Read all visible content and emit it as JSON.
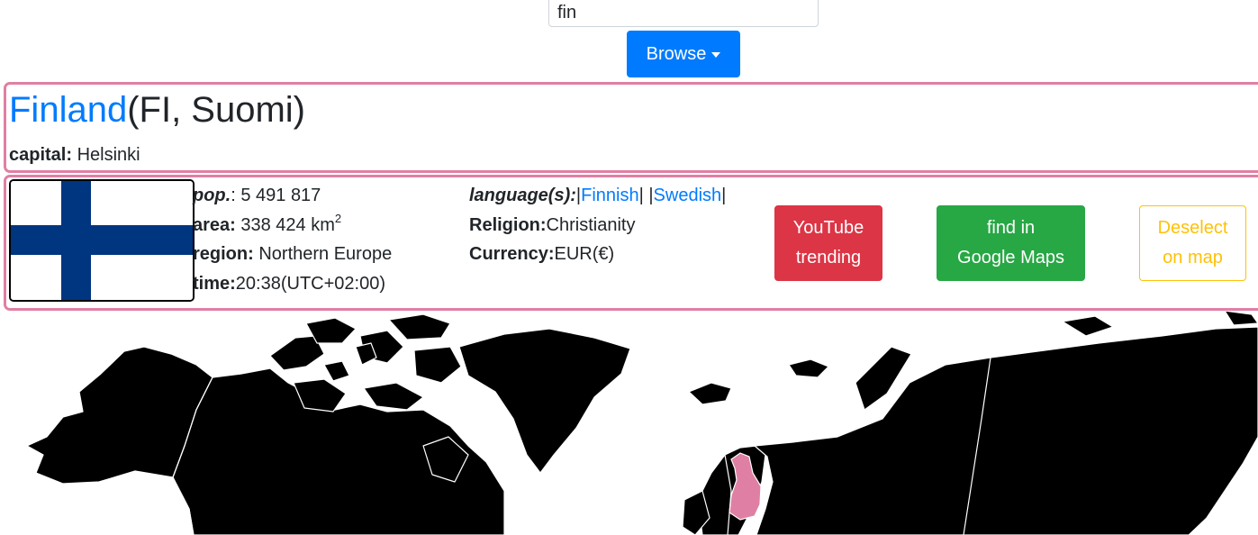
{
  "search": {
    "value": "fin",
    "placeholder": ""
  },
  "browse_button": {
    "label": "Browse"
  },
  "country": {
    "name": "Finland",
    "codes": "(FI, Suomi)",
    "capital_label": "capital:",
    "capital_value": "Helsinki"
  },
  "flag": {
    "icon": "finland-flag",
    "background_color": "#ffffff",
    "cross_color": "#003580"
  },
  "stats": {
    "population_label": "pop.",
    "population_value": ": 5 491 817",
    "area_label": "area:",
    "area_value": "338 424 km",
    "area_unit_sup": "2",
    "region_label": "region:",
    "region_value": "Northern Europe",
    "time_label": "time:",
    "time_value": "20:38(UTC+02:00)"
  },
  "culture": {
    "languages_label": "language(s):",
    "languages": [
      "Finnish",
      "Swedish"
    ],
    "religion_label": "Religion:",
    "religion_value": "Christianity",
    "currency_label": "Currency:",
    "currency_value": "EUR(€)"
  },
  "actions": {
    "youtube_line1": "YouTube",
    "youtube_line2": "trending",
    "maps_line1": "find in",
    "maps_line2": "Google Maps",
    "deselect_line1": "Deselect",
    "deselect_line2": "on map"
  },
  "map": {
    "land_color": "#000000",
    "border_color": "#ffffff",
    "highlight_color": "#e07fa4",
    "highlighted_country": "Finland"
  },
  "colors": {
    "primary": "#007bff",
    "danger": "#dc3545",
    "success": "#28a745",
    "warning": "#ffc107",
    "card_border": "#e07fa4"
  }
}
